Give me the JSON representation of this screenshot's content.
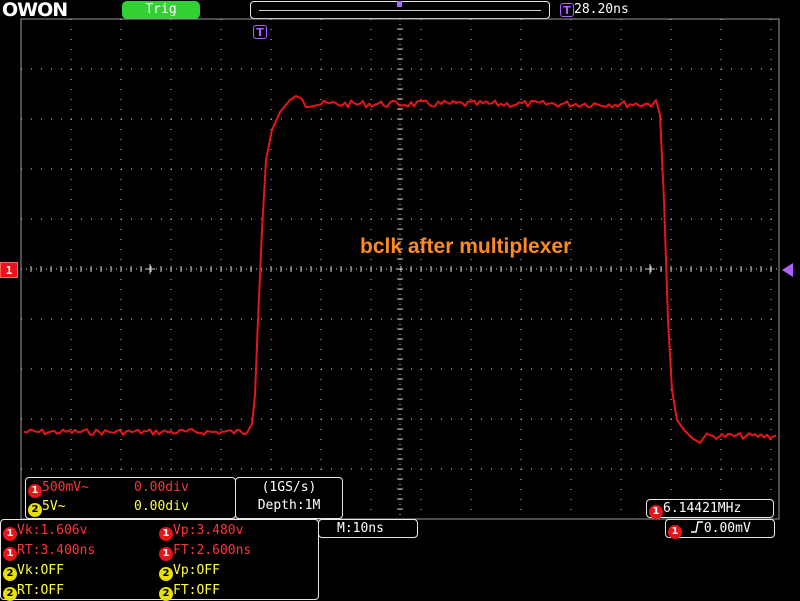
{
  "brand": {
    "logo_text": "OWON"
  },
  "header": {
    "trigger_status": "Trig",
    "trigger_time_badge": "T",
    "trigger_delay": "28.20ns"
  },
  "screen": {
    "channel_marker": "1",
    "annotation": "bclk after multiplexer",
    "frequency_badge": "1",
    "frequency": "6.14421MHz"
  },
  "channels": [
    {
      "badge": "1",
      "scale": "500mV~",
      "offset": "0.00div"
    },
    {
      "badge": "2",
      "scale": "5V~",
      "offset": "0.00div"
    }
  ],
  "acquisition": {
    "sample_rate": "(1GS/s)",
    "depth": "Depth:1M"
  },
  "timebase": {
    "label": "M:10ns"
  },
  "trigger_info": {
    "badge": "1",
    "edge_icon": "rising-edge-icon",
    "level": "0.00mV"
  },
  "measurements": [
    {
      "badge": "1",
      "label": "Vk:",
      "value": "1.606v",
      "badge2": "1",
      "label2": "Vp:",
      "value2": "3.480v"
    },
    {
      "badge": "1",
      "label": "RT:",
      "value": "3.400ns",
      "badge2": "1",
      "label2": "FT:",
      "value2": "2.600ns"
    },
    {
      "badge": "2",
      "label": "Vk:",
      "value": "OFF",
      "badge2": "2",
      "label2": "Vp:",
      "value2": "OFF"
    },
    {
      "badge": "2",
      "label": "RT:",
      "value": "OFF",
      "badge2": "2",
      "label2": "FT:",
      "value2": "OFF"
    }
  ],
  "colors": {
    "ch1": "#e8141a",
    "ch2": "#e8e000",
    "trigger_ok": "#33d033",
    "trigger_marker": "#b060ff",
    "annotation": "#ff8a1f",
    "grid": "#cfcfcf"
  }
}
